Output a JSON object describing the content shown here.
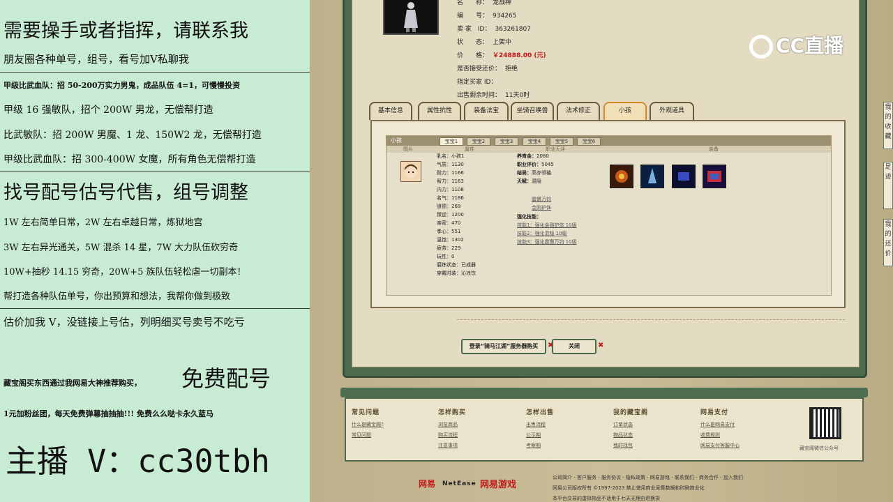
{
  "left_panel": {
    "heading1": "需要操手或者指挥，请联系我",
    "line1": "朋友圈各种单号，组号，看号加Ⅴ私聊我",
    "line2": "甲级比武血队：招 50-200万实力男鬼，成品队伍 4=1，可慢慢投资",
    "line3": "甲级 16 强敏队，招个 200W 男龙，无偿帮打造",
    "line4": "比武敏队：招 200W 男魔、1 龙、150W2 龙，无偿帮打造",
    "line5": "甲级比武血队：招 300-400W 女魔，所有角色无偿帮打造",
    "heading2": "找号配号估号代售，组号调整",
    "line6": "1W 左右简单日常，2W 左右卓越日常，炼狱地宫",
    "line7": "3W 左右异光通关，5W 混杀 14 星，7W 大力队伍砍穷奇",
    "line8": "10W+抽秒 14.15 穷奇，20W+5 族队伍轻松虐一切副本！",
    "line9": "帮打造各种队伍单号，你出预算和想法，我帮你做到极致",
    "line10": "估价加我 V，没链接上号估，列明细买号卖号不吃亏",
    "small_promo": "藏宝阁买东西通过我网易大神推荐购买，",
    "big_promo": "免费配号",
    "line11": "1元加粉丝团，每天免费弹幕抽抽抽!!! 免费么么哒卡永久蓝马",
    "contact": "主播 V：cc30tbh"
  },
  "item": {
    "name_label": "名　　称：",
    "name_value": "龙战神",
    "id_label": "编　　号：",
    "id_value": "934265",
    "seller_label": "卖 家　ID：",
    "seller_value": "363261807",
    "status_label": "状　　态：",
    "status_value": "上架中",
    "price_label": "价　　格：",
    "price_value": "￥24888.00 (元)",
    "bargain_label": "是否接受还价：",
    "bargain_value": "拒绝",
    "buyer_label": "指定买家 ID：",
    "buyer_value": "",
    "remain_label": "出售剩余时间：",
    "remain_value": "11天0时"
  },
  "tabs": [
    "基本信息",
    "属性抗性",
    "装备法宝",
    "坐骑召唤兽",
    "法术修正",
    "小孩",
    "外观道具"
  ],
  "child": {
    "section_label": "小孩",
    "subtabs": [
      "宝宝1",
      "宝宝2",
      "宝宝3",
      "宝宝4",
      "宝宝5",
      "宝宝6"
    ],
    "col_image": "图片",
    "col_attr": "属性",
    "col_talent": "职业天评",
    "col_equip": "装备",
    "stats": [
      {
        "label": "乳名：",
        "value": "小孩1"
      },
      {
        "label": "气质：",
        "value": "1130"
      },
      {
        "label": "耐力：",
        "value": "1166"
      },
      {
        "label": "智力：",
        "value": "1163"
      },
      {
        "label": "内力：",
        "value": "1108"
      },
      {
        "label": "名气：",
        "value": "1186"
      },
      {
        "label": "道德：",
        "value": "269"
      },
      {
        "label": "叛逆：",
        "value": "1200"
      },
      {
        "label": "亲密：",
        "value": "470"
      },
      {
        "label": "孝心：",
        "value": "551"
      },
      {
        "label": "温饱：",
        "value": "1302"
      },
      {
        "label": "疲劳：",
        "value": "229"
      },
      {
        "label": "玩性：",
        "value": "0"
      },
      {
        "label": "磨炼状态：",
        "value": "已成器"
      },
      {
        "label": "穿戴时装：",
        "value": "沁凉饮"
      }
    ],
    "info": [
      {
        "label": "养育金：",
        "value": "2080"
      },
      {
        "label": "职业评价：",
        "value": "5045"
      },
      {
        "label": "结局：",
        "value": "高亦领袖"
      },
      {
        "label": "天赋：",
        "value": "混隐"
      }
    ],
    "talent_links": [
      "震慑万钧",
      "金刚护体"
    ],
    "skill_label": "强化技能：",
    "skills": [
      "技能1：强化金刚护体 10级",
      "技能2：强化混隐 10级",
      "技能3：强化震慑万钧 10级"
    ]
  },
  "buttons": {
    "server_buy": "登录“骑马江湖”服务器购买",
    "close": "关闭"
  },
  "footer": {
    "cols": [
      {
        "title": "常见问题",
        "links": [
          "什么是藏宝阁?",
          "常见问题"
        ]
      },
      {
        "title": "怎样购买",
        "links": [
          "浏览商品",
          "购买流程",
          "注意事项"
        ]
      },
      {
        "title": "怎样出售",
        "links": [
          "出售流程",
          "公示期",
          "考察期"
        ]
      },
      {
        "title": "我的藏宝阁",
        "links": [
          "订单状态",
          "物品状态",
          "我的找包"
        ]
      },
      {
        "title": "网易支付",
        "links": [
          "什么是网易支付",
          "收费规则",
          "网易支付客服中心"
        ]
      }
    ],
    "qr_caption": "藏宝阁微信公众号",
    "legal1": "公司简介 - 客户服务 - 服务协议 - 隐私政策 - 网易游戏 - 联系我们 - 商务合作 - 加入我们",
    "legal2": "网易公司版权所有 ©1997-2023 禁止使用商业采集数据和时刷商业化",
    "legal3": "本平台交易的虚拟物品不适用于七天无理由退换货",
    "logo_163": "网易",
    "logo_netease": "NetEase",
    "logo_game": "网易游戏"
  },
  "watermark": "CC直播",
  "edge_tabs": [
    "我的收藏",
    "足迹",
    "我的还价"
  ],
  "colors": {
    "accent_red": "#c01818",
    "panel_green": "#c8ebd4",
    "frame_green": "#4c6a4c"
  }
}
